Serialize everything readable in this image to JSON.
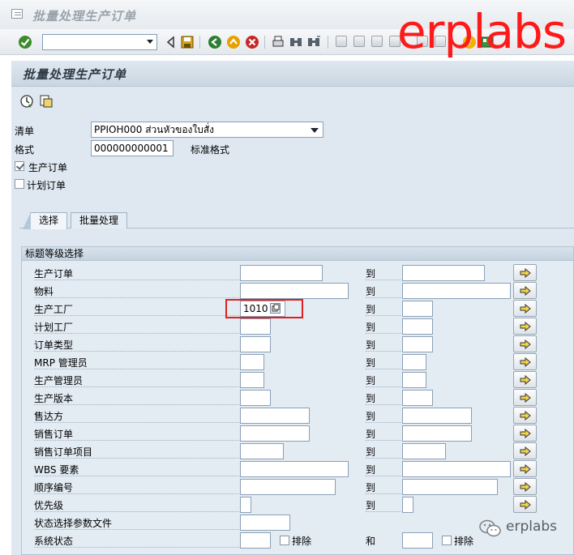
{
  "window": {
    "title": "批量处理生产订单"
  },
  "watermark": {
    "text": "erplabs",
    "color": "#ff1a1a"
  },
  "toolbar": {
    "command_field": "",
    "icons": [
      "enter-icon",
      "back-icon",
      "save-icon",
      "green-back-icon",
      "exit-icon",
      "cancel-icon",
      "print-icon",
      "find-icon",
      "find-next-icon",
      "first-page-icon",
      "prev-page-icon",
      "next-page-icon",
      "last-page-icon",
      "create-session-icon",
      "shortcut-icon",
      "help-icon",
      "layout-icon"
    ]
  },
  "screen": {
    "title": "批量处理生产订单",
    "app_toolbar": [
      "execute-icon",
      "get-variant-icon"
    ]
  },
  "header_fields": {
    "list_label": "清单",
    "list_value": "PPIOH000 ส่วนหัวของใบสั่ง",
    "layout_label": "格式",
    "layout_value": "000000000001",
    "layout_desc": "标准格式",
    "prod_order_cb_label": "生产订单",
    "prod_order_cb_checked": true,
    "planned_order_cb_label": "计划订单",
    "planned_order_cb_checked": false
  },
  "tabs": [
    {
      "label": "选择",
      "active": true
    },
    {
      "label": "批量处理",
      "active": false
    }
  ],
  "selection": {
    "group_title": "标题等级选择",
    "to_label": "到",
    "rows": [
      {
        "label": "生产订单",
        "from": "",
        "to": ""
      },
      {
        "label": "物料",
        "from": "",
        "to": ""
      },
      {
        "label": "生产工厂",
        "from": "1010",
        "to": ""
      },
      {
        "label": "计划工厂",
        "from": "",
        "to": ""
      },
      {
        "label": "订单类型",
        "from": "",
        "to": ""
      },
      {
        "label": "MRP 管理员",
        "from": "",
        "to": ""
      },
      {
        "label": "生产管理员",
        "from": "",
        "to": ""
      },
      {
        "label": "生产版本",
        "from": "",
        "to": ""
      },
      {
        "label": "售达方",
        "from": "",
        "to": ""
      },
      {
        "label": "销售订单",
        "from": "",
        "to": ""
      },
      {
        "label": "销售订单项目",
        "from": "",
        "to": ""
      },
      {
        "label": "WBS 要素",
        "from": "",
        "to": ""
      },
      {
        "label": "顺序编号",
        "from": "",
        "to": ""
      },
      {
        "label": "优先级",
        "from": "",
        "to": ""
      }
    ],
    "status_profile_label": "状态选择参数文件",
    "status_profile_value": "",
    "system_status_label": "系统状态",
    "system_status_value": "",
    "exclude_label": "排除",
    "and_label": "和",
    "system_status_value2": ""
  },
  "wechat": {
    "text": "erplabs"
  }
}
